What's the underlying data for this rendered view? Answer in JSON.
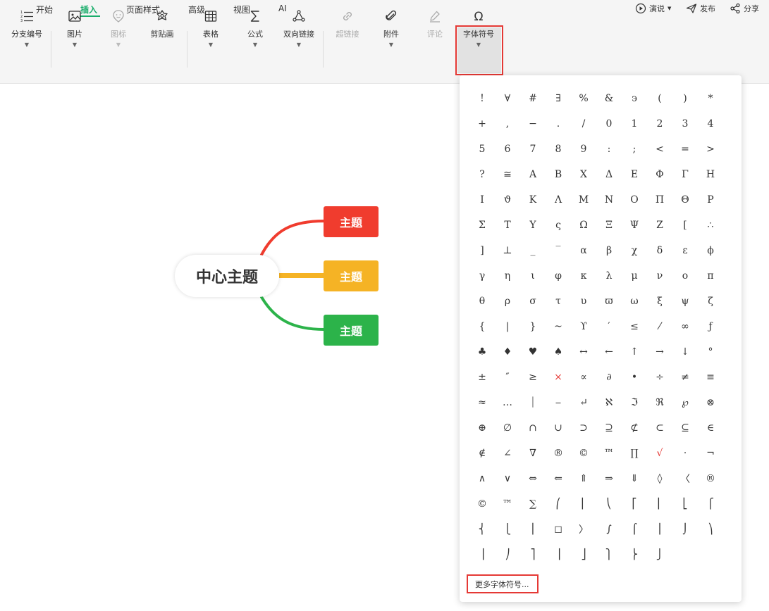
{
  "menu": {
    "tabs": [
      {
        "label": "开始"
      },
      {
        "label": "插入",
        "active": true
      },
      {
        "label": "页面样式"
      },
      {
        "label": "高级"
      },
      {
        "label": "视图"
      },
      {
        "label": "AI"
      }
    ],
    "right": {
      "present": "演说",
      "publish": "发布",
      "share": "分享"
    }
  },
  "toolbar": {
    "tools": [
      {
        "label": "分支编号",
        "icon": "numbered-list-icon",
        "caret": "▼",
        "disabled": false
      },
      {
        "label": "图片",
        "icon": "image-icon",
        "caret": "▼",
        "disabled": false
      },
      {
        "label": "图标",
        "icon": "smiley-icon",
        "caret": "▼",
        "disabled": true
      },
      {
        "label": "剪贴画",
        "icon": "flower-icon",
        "caret": "",
        "disabled": false
      },
      {
        "label": "表格",
        "icon": "table-icon",
        "caret": "▼",
        "disabled": false
      },
      {
        "label": "公式",
        "icon": "sigma-icon",
        "caret": "▼",
        "disabled": false
      },
      {
        "label": "双向链接",
        "icon": "graph-link-icon",
        "caret": "▼",
        "disabled": false
      },
      {
        "label": "超链接",
        "icon": "hyperlink-icon",
        "caret": "",
        "disabled": true
      },
      {
        "label": "附件",
        "icon": "paperclip-icon",
        "caret": "▼",
        "disabled": false
      },
      {
        "label": "评论",
        "icon": "comment-pen-icon",
        "caret": "",
        "disabled": true
      },
      {
        "label": "字体符号",
        "icon": "omega-icon",
        "caret": "▼",
        "disabled": false
      }
    ]
  },
  "mindmap": {
    "center": "中心主题",
    "topics": [
      {
        "label": "主题",
        "color": "#f03c2e"
      },
      {
        "label": "主题",
        "color": "#f5b325"
      },
      {
        "label": "主题",
        "color": "#2cb34a"
      }
    ]
  },
  "symbol_panel": {
    "symbols": [
      "!",
      "∀",
      "#",
      "∃",
      "%",
      "&",
      "϶",
      "(",
      ")",
      "*",
      "+",
      ",",
      "−",
      ".",
      "/",
      "0",
      "1",
      "2",
      "3",
      "4",
      "5",
      "6",
      "7",
      "8",
      "9",
      ":",
      ";",
      "<",
      "=",
      ">",
      "?",
      "≅",
      "Α",
      "Β",
      "Χ",
      "Δ",
      "Ε",
      "Φ",
      "Γ",
      "Η",
      "Ι",
      "ϑ",
      "Κ",
      "Λ",
      "Μ",
      "Ν",
      "Ο",
      "Π",
      "Θ",
      "Ρ",
      "Σ",
      "Τ",
      "Υ",
      "ς",
      "Ω",
      "Ξ",
      "Ψ",
      "Ζ",
      "[",
      "∴",
      "]",
      "⊥",
      "_",
      "‾",
      "α",
      "β",
      "χ",
      "δ",
      "ε",
      "ϕ",
      "γ",
      "η",
      "ι",
      "φ",
      "κ",
      "λ",
      "μ",
      "ν",
      "ο",
      "π",
      "θ",
      "ρ",
      "σ",
      "τ",
      "υ",
      "ϖ",
      "ω",
      "ξ",
      "ψ",
      "ζ",
      "{",
      "|",
      "}",
      "~",
      "ϒ",
      "′",
      "≤",
      "⁄",
      "∞",
      "ƒ",
      "♣",
      "♦",
      "♥",
      "♠",
      "↔",
      "←",
      "↑",
      "→",
      "↓",
      "°",
      "±",
      "″",
      "≥",
      "×",
      "∝",
      "∂",
      "•",
      "÷",
      "≠",
      "≡",
      "≈",
      "…",
      "⏐",
      "⎯",
      "↵",
      "ℵ",
      "ℑ",
      "ℜ",
      "℘",
      "⊗",
      "⊕",
      "∅",
      "∩",
      "∪",
      "⊃",
      "⊇",
      "⊄",
      "⊂",
      "⊆",
      "∈",
      "∉",
      "∠",
      "∇",
      "®",
      "©",
      "™",
      "∏",
      "√",
      "⋅",
      "¬",
      "∧",
      "∨",
      "⇔",
      "⇐",
      "⇑",
      "⇒",
      "⇓",
      "◊",
      "〈",
      "®",
      "©",
      "™",
      "∑",
      "⎛",
      "⎜",
      "⎝",
      "⎡",
      "⎢",
      "⎣",
      "⎧",
      "⎨",
      "⎩",
      "⎪",
      "◻",
      "〉",
      "∫",
      "⌠",
      "⎮",
      "⌡",
      "⎞",
      "⎟",
      "⎠",
      "⎤",
      "⎥",
      "⎦",
      "⎫",
      "⎬",
      "⎭"
    ],
    "red_symbols": [
      "×",
      "√"
    ],
    "more_label": "更多字体符号..."
  }
}
